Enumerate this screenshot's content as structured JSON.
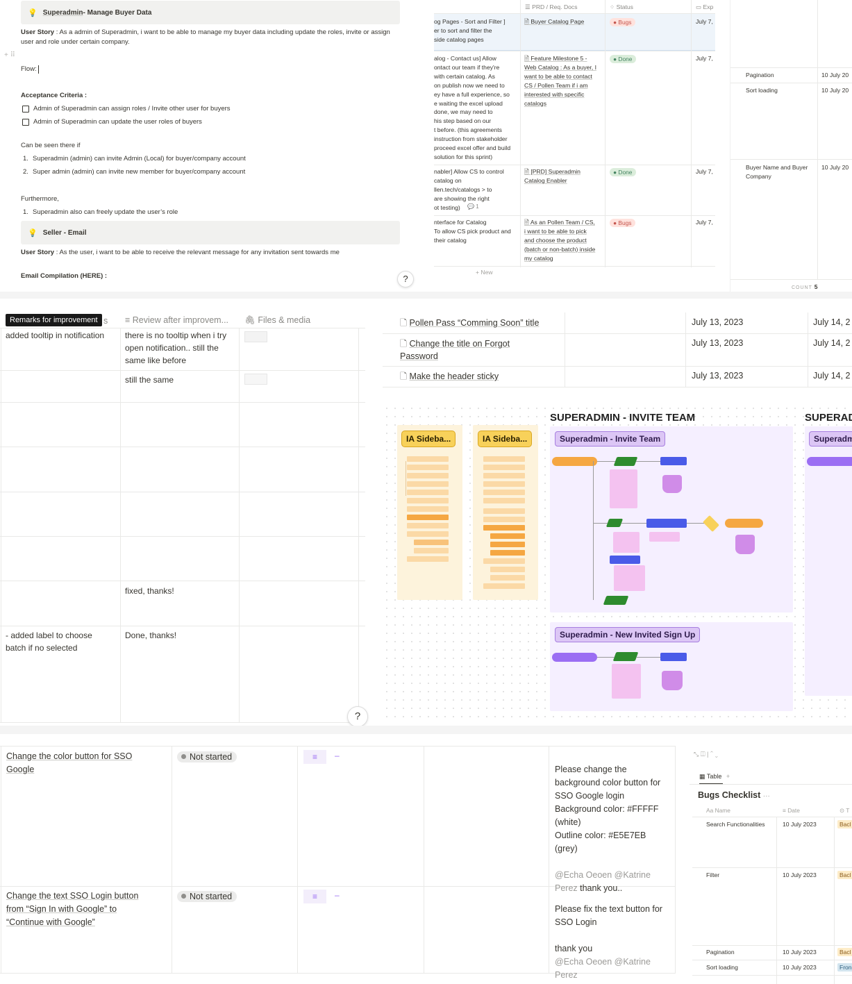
{
  "doc": {
    "callout1": {
      "title_link": "Superadmin",
      "title_rest": " - Manage Buyer Data"
    },
    "user_story1_label": "User Story",
    "user_story1_line1": " : As a admin of Superadmin, i want to be able to manage my buyer data including update the roles, invite or assign",
    "user_story1_line2": "user and role  under certain company.",
    "flow_label": "Flow:",
    "acceptance_label": "Acceptance Criteria :",
    "criteria": [
      "Admin of Superadmin can assign roles  / Invite other user for buyers",
      "Admin of Superadmin can update the user roles of buyers"
    ],
    "can_be_seen": "Can be seen there if",
    "seen_items": [
      "Superadmin (admin) can invite Admin (Local) for buyer/company account",
      "Super admin (admin) can invite new member for buyer/company account"
    ],
    "furthermore": "Furthermore,",
    "further_items": [
      "Superadmin also can freely update the user’s role"
    ],
    "callout2": {
      "title": "Seller - Email"
    },
    "user_story2_label": "User Story",
    "user_story2_text": " : As the user, i want to be able to receive the relevant message for any invitation sent towards me",
    "email_compilation": "Email Compilation (HERE) :",
    "help": "?"
  },
  "prd_table": {
    "headers": [
      "PRD / Req. Docs",
      "Status",
      "Exp"
    ],
    "rows": [
      {
        "name": "og Pages - Sort and Filter ]\ner to sort and filter the\nside catalog pages",
        "doc": "Buyer Catalog Page",
        "status": "Bugs",
        "date": "July 7,"
      },
      {
        "name": "alog - Contact us] Allow\nontact our team if they're\nwith certain catalog. As\non publish now we need to\ney have a full experience, so\ne waiting the excel upload\n done, we may need to\nhis step based on our\nt before. (this agreements\ninstruction from stakeholder\nproceed excel offer and build\n solution for this sprint)",
        "doc": "Feature Milestone 5 -\nWeb Catalog : As a buyer, I\nwant to be able to contact\nCS / Pollen Team if i am\ninterested with specific\ncatalogs",
        "status": "Done",
        "date": "July 7,"
      },
      {
        "name": "nabler] Allow CS to control\n catalog on\nllen.tech/catalogs > to\n are showing the right\not testing)",
        "comments": "1",
        "doc": "[PRD] Superadmin\nCatalog Enabler",
        "status": "Done",
        "date": "July 7,"
      },
      {
        "name": "nterface for Catalog\nTo allow CS pick product and\ntheir catalog",
        "doc": "As an Pollen Team / CS,\ni want to be able to pick\nand choose the product\n(batch or non-batch) inside\nmy catalog",
        "status": "Bugs",
        "date": "July 7,"
      }
    ],
    "new_label": "New"
  },
  "mini_list": {
    "rows": [
      {
        "name": "Pagination",
        "date": "10 July 20"
      },
      {
        "name": "Sort loading",
        "date": "10 July 20"
      },
      {
        "name": "Buyer Name and Buyer\nCompany",
        "date": "10 July 20"
      }
    ],
    "count_label": "COUNT",
    "count_value": "5"
  },
  "remarks_table": {
    "tooltip": "Remarks for improvement",
    "header_tail": "s",
    "headers": [
      "Review after improvem...",
      "Files & media"
    ],
    "rows": [
      {
        "remark": "added tooltip in notification",
        "review": "there is no tooltip when i try\nopen notification.. still the\nsame like before"
      },
      {
        "remark": "",
        "review": "still the same"
      },
      {
        "remark": "",
        "review": ""
      },
      {
        "remark": "",
        "review": ""
      },
      {
        "remark": "",
        "review": ""
      },
      {
        "remark": "",
        "review": ""
      },
      {
        "remark": "",
        "review": "fixed, thanks!"
      },
      {
        "remark": "- added label to choose\nbatch if no selected",
        "review": "Done, thanks!"
      }
    ],
    "help": "?"
  },
  "page_list": {
    "rows": [
      {
        "title": "Pollen Pass “Comming Soon” title",
        "date1": "July 13, 2023",
        "date2": "July 14, 2"
      },
      {
        "title": "Change the title on Forgot\nPassword",
        "date1": "July 13, 2023",
        "date2": "July 14, 2"
      },
      {
        "title": "Make the header sticky",
        "date1": "July 13, 2023",
        "date2": "July 14, 2"
      }
    ]
  },
  "whiteboard": {
    "title1": "SUPERADMIN - INVITE TEAM",
    "title2": "SUPERAD",
    "ia_chip1": "IA Sideba...",
    "ia_chip2": "IA Sideba...",
    "frame1_label": "Superadmin - Invite Team",
    "frame2_label": "Superadmin - New Invited Sign Up",
    "frame3_label": "Superadm",
    "colors": {
      "purple": "#9b6ef3",
      "orange": "#f5a742",
      "green": "#2e8b2e",
      "blue": "#4a5be8",
      "pink": "#f4c2f0",
      "yellow": "#f8d15a"
    }
  },
  "bug_table": {
    "rows": [
      {
        "title": "Change the color button for SSO\nGoogle",
        "status": "Not started",
        "comment": "Please change the\nbackground color button for\nSSO Google login\nBackground color: #FFFFF\n(white)\nOutline color: #E5E7EB\n(grey)",
        "mentions": "@Echa Oeoen @Katrine\nPerez",
        "thanks": " thank you.."
      },
      {
        "title": "Change the text SSO Login button\nfrom “Sign In with Google” to\n“Continue with Google”",
        "status": "Not started",
        "comment": "Please fix the text button for\nSSO Login\n\nthank you",
        "mentions": "@Echa Oeoen @Katrine\nPerez",
        "thanks": ""
      }
    ]
  },
  "bugs_checklist": {
    "view_tab": "Table",
    "add": "+",
    "title": "Bugs Checklist",
    "more": "···",
    "headers": [
      "Aa Name",
      "Date",
      "T"
    ],
    "rows": [
      {
        "name": "Search Functionalities",
        "date": "10 July 2023",
        "tag": "Bacl"
      },
      {
        "name": "Filter",
        "date": "10 July 2023",
        "tag": "Bacl"
      },
      {
        "name": "Pagination",
        "date": "10 July 2023",
        "tag": "Bacl"
      },
      {
        "name": "Sort loading",
        "date": "10 July 2023",
        "tag": "Fron"
      }
    ]
  }
}
